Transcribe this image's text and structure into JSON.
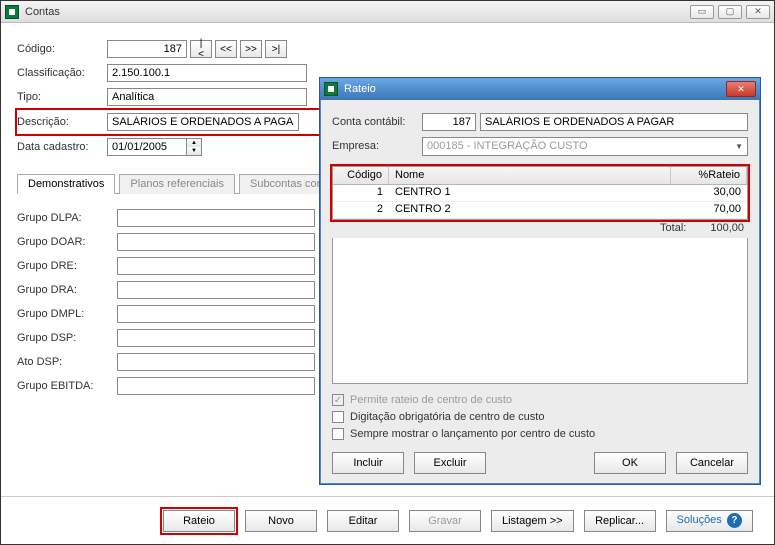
{
  "app": {
    "title": "Contas"
  },
  "window_controls": {
    "min": "▭",
    "max": "▢",
    "close": "✕"
  },
  "form": {
    "codigo_label": "Código:",
    "codigo_value": "187",
    "nav": {
      "first": "|<",
      "prev": "<<",
      "next": ">>",
      "last": ">|"
    },
    "classificacao_label": "Classificação:",
    "classificacao_value": "2.150.100.1",
    "tipo_label": "Tipo:",
    "tipo_value": "Analítica",
    "descricao_label": "Descrição:",
    "descricao_value": "SALÁRIOS E ORDENADOS A PAGAR",
    "data_cadastro_label": "Data cadastro:",
    "data_cadastro_value": "01/01/2005"
  },
  "tabs": {
    "demonstrativos": "Demonstrativos",
    "planos": "Planos referenciais",
    "subcontas": "Subcontas correlatas"
  },
  "groups": {
    "dlpa": "Grupo DLPA:",
    "doar": "Grupo DOAR:",
    "dre": "Grupo DRE:",
    "dra": "Grupo DRA:",
    "dmpl": "Grupo DMPL:",
    "dsp": "Grupo DSP:",
    "ato_dsp": "Ato DSP:",
    "ebitda": "Grupo EBITDA:"
  },
  "buttons": {
    "rateio": "Rateio",
    "novo": "Novo",
    "editar": "Editar",
    "gravar": "Gravar",
    "listagem": "Listagem >>",
    "replicar": "Replicar...",
    "solucoes": "Soluções"
  },
  "dialog": {
    "title": "Rateio",
    "conta_label": "Conta contábil:",
    "conta_code": "187",
    "conta_name": "SALÁRIOS E ORDENADOS A PAGAR",
    "empresa_label": "Empresa:",
    "empresa_value": "000185 - INTEGRAÇÃO CUSTO",
    "grid": {
      "col_codigo": "Código",
      "col_nome": "Nome",
      "col_pct": "%Rateio",
      "rows": [
        {
          "codigo": "1",
          "nome": "CENTRO 1",
          "pct": "30,00"
        },
        {
          "codigo": "2",
          "nome": "CENTRO 2",
          "pct": "70,00"
        }
      ],
      "total_label": "Total:",
      "total_value": "100,00"
    },
    "checks": {
      "permite": "Permite rateio de centro de custo",
      "digitacao": "Digitação obrigatória de centro de custo",
      "sempre": "Sempre mostrar o lançamento por centro de custo"
    },
    "buttons": {
      "incluir": "Incluir",
      "excluir": "Excluir",
      "ok": "OK",
      "cancelar": "Cancelar"
    }
  }
}
